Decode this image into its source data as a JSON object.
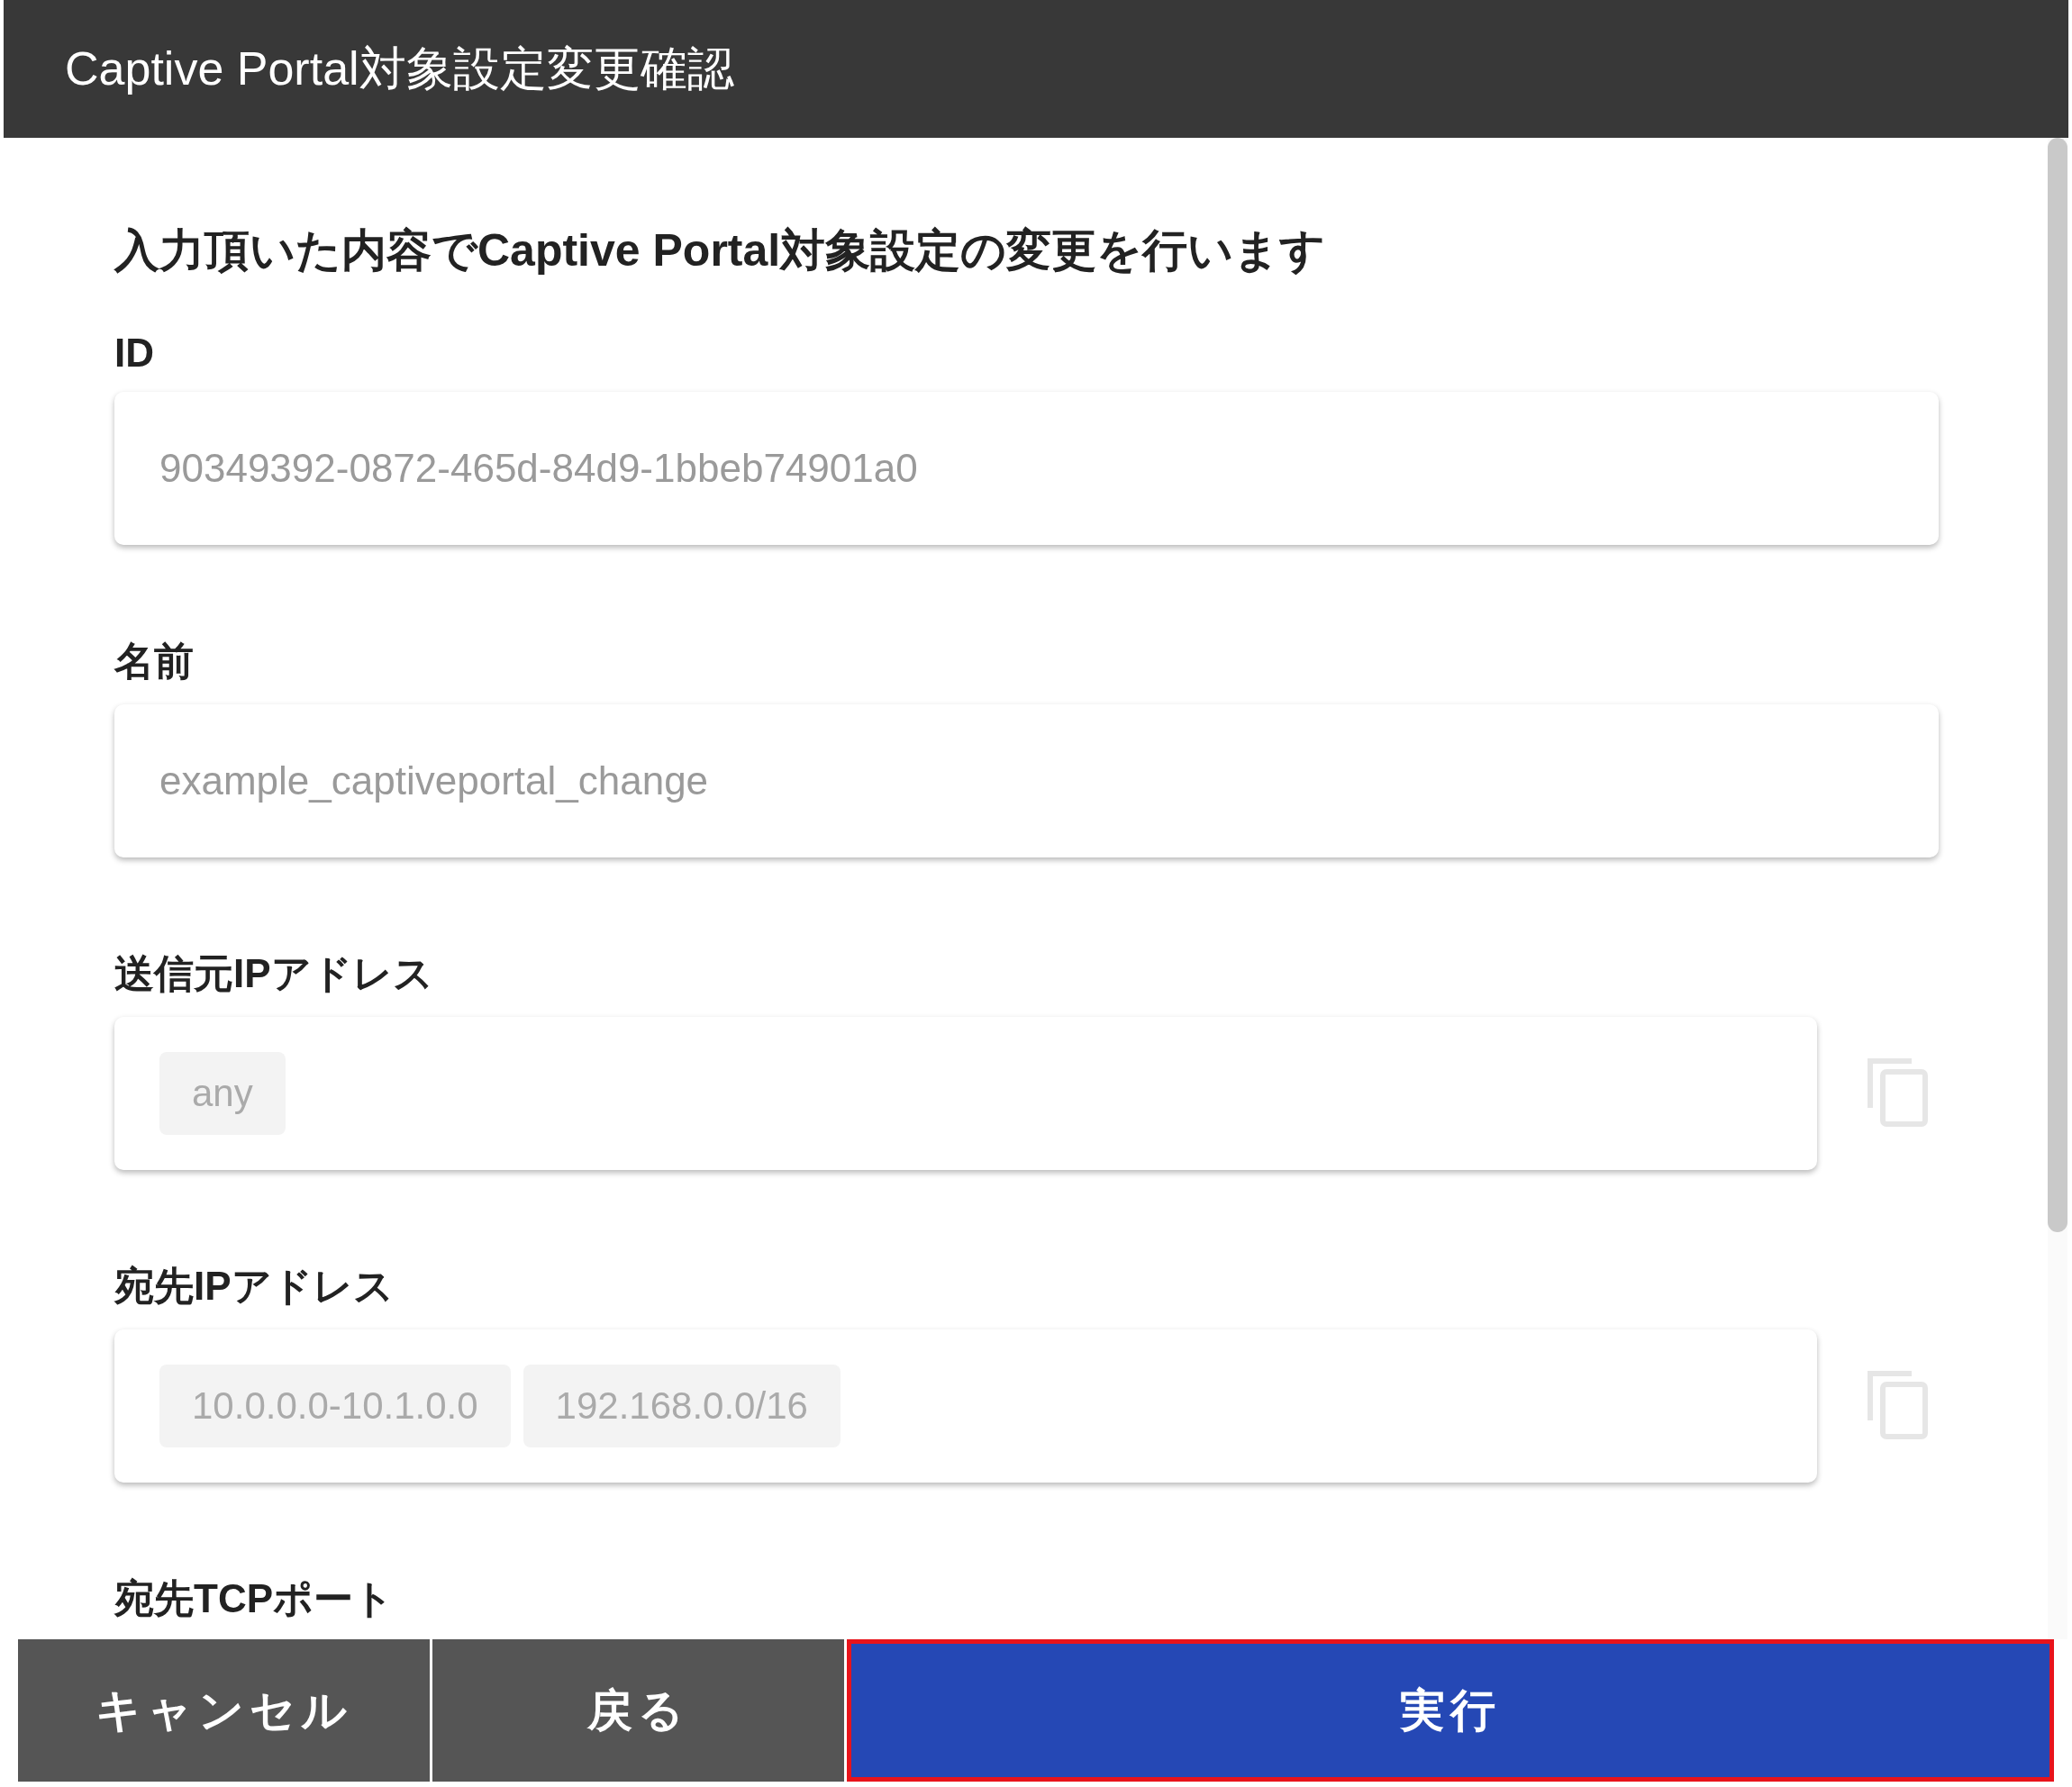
{
  "header": {
    "title": "Captive Portal対象設定変更確認"
  },
  "message": "入力頂いた内容でCaptive Portal対象設定の変更を行います",
  "fields": [
    {
      "label": "ID",
      "kind": "text",
      "value": "90349392-0872-465d-84d9-1bbeb74901a0"
    },
    {
      "label": "名前",
      "kind": "text",
      "value": "example_captiveportal_change"
    },
    {
      "label": "送信元IPアドレス",
      "kind": "chips",
      "chips": [
        "any"
      ]
    },
    {
      "label": "宛先IPアドレス",
      "kind": "chips",
      "chips": [
        "10.0.0.0-10.1.0.0",
        "192.168.0.0/16"
      ]
    },
    {
      "label": "宛先TCPポート",
      "kind": "label-only"
    }
  ],
  "buttons": [
    {
      "label": "キャンセル",
      "kind": "secondary",
      "highlighted": false
    },
    {
      "label": "戻る",
      "kind": "secondary",
      "highlighted": false
    },
    {
      "label": "実行",
      "kind": "primary",
      "highlighted": true
    }
  ]
}
